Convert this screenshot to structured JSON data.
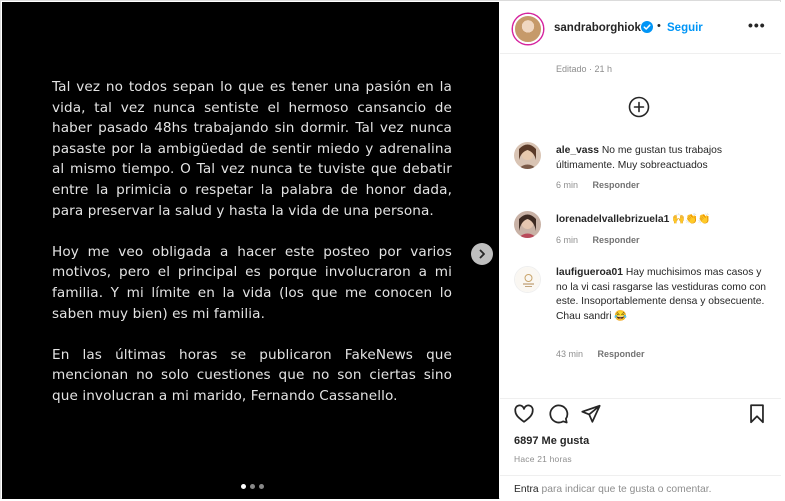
{
  "post": {
    "paragraphs": [
      "Tal vez no todos sepan lo que es tener una pasión en la vida, tal vez nunca sentiste el hermoso cansancio de haber pasado 48hs trabajando sin dormir. Tal vez nunca pasaste por la ambigüedad de sentir miedo y adrenalina al mismo tiempo. O Tal vez nunca te tuviste que debatir entre la primicia o respetar la palabra de honor dada, para preservar la salud y hasta la vida de una persona.",
      "Hoy me veo obligada a hacer este posteo por varios motivos, pero el principal es porque involucraron a mi familia. Y mi límite en la vida (los que me conocen lo saben muy bien) es mi familia.",
      "En las últimas horas se publicaron FakeNews que mencionan no solo cuestiones que no son ciertas sino que involucran a mi marido, Fernando Cassanello."
    ],
    "carousel": {
      "total": 3,
      "active": 1
    }
  },
  "header": {
    "username": "sandraborghiok",
    "separator": "•",
    "follow_label": "Seguir",
    "more_label": "•••"
  },
  "edited_label": "Editado · 21 h",
  "comments": [
    {
      "user": "ale_vass",
      "text": "No me gustan tus trabajos últimamente. Muy sobreactuados",
      "time": "6 min",
      "reply": "Responder"
    },
    {
      "user": "lorenadelvallebrizuela1",
      "text": "🙌👏👏",
      "time": "6 min",
      "reply": "Responder"
    },
    {
      "user": "laufigueroa01",
      "text": "Hay muchisimos mas casos y no la vi casi rasgarse las vestiduras como con este. Insoportablemente densa y obsecuente. Chau sandri 😂",
      "time": "43 min",
      "reply": "Responder"
    }
  ],
  "stats": {
    "likes": "6897 Me gusta",
    "time_ago": "Hace 21 horas"
  },
  "add_comment": {
    "enter": "Entra",
    "rest": " para indicar que te gusta o comentar."
  },
  "colors": {
    "follow": "#0095f6",
    "verified": "#0095f6",
    "muted": "#8e8e8e"
  }
}
